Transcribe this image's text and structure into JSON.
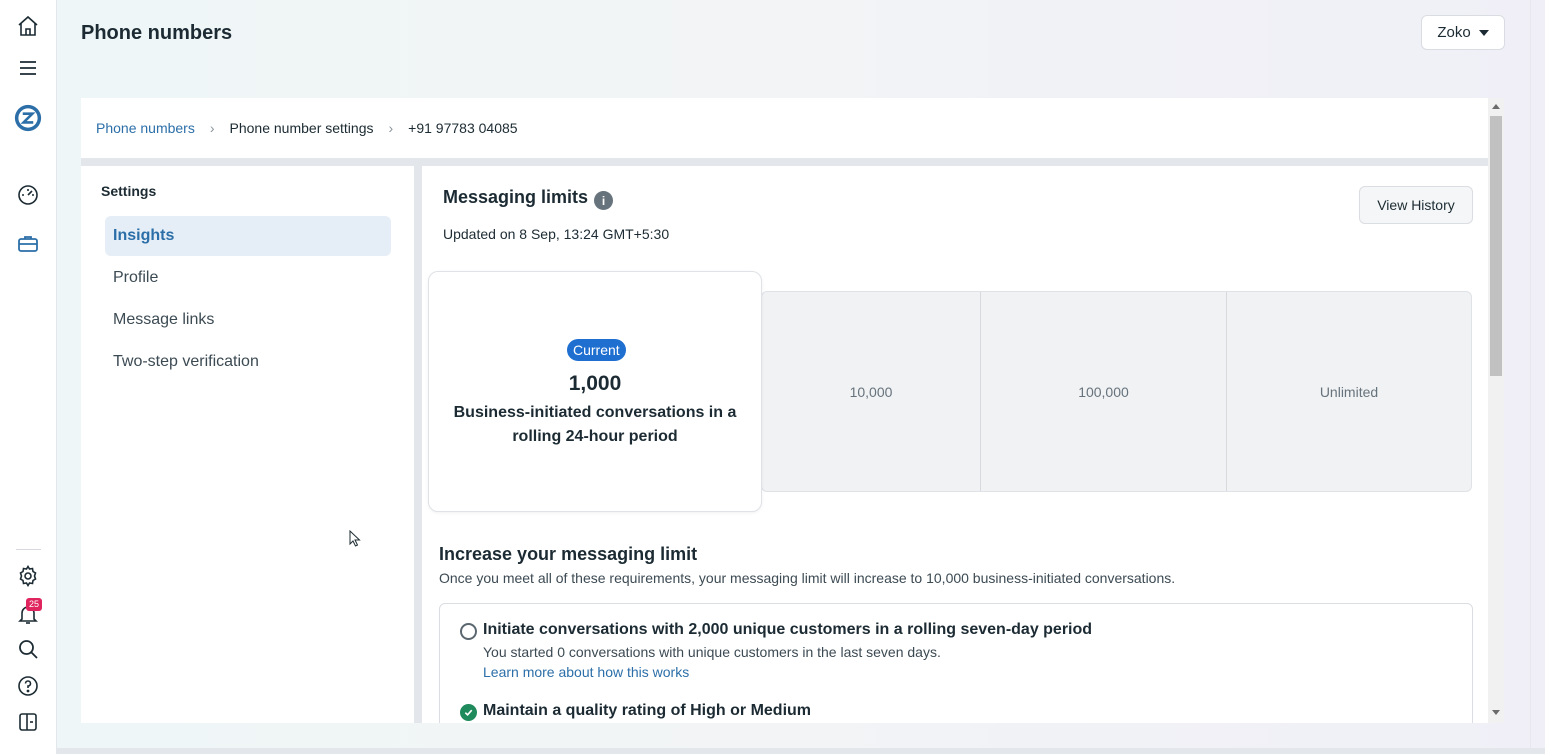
{
  "header": {
    "title": "Phone numbers",
    "account_label": "Zoko"
  },
  "breadcrumb": {
    "items": [
      "Phone numbers",
      "Phone number settings",
      "+91 97783 04085"
    ]
  },
  "settings": {
    "title": "Settings",
    "items": [
      {
        "label": "Insights",
        "active": true
      },
      {
        "label": "Profile",
        "active": false
      },
      {
        "label": "Message links",
        "active": false
      },
      {
        "label": "Two-step verification",
        "active": false
      }
    ]
  },
  "messaging_limits": {
    "title": "Messaging limits",
    "info_icon": "i",
    "updated": "Updated on 8 Sep, 13:24 GMT+5:30",
    "view_history": "View History",
    "current_pill": "Current",
    "current_value": "1,000",
    "current_desc": "Business-initiated conversations in a rolling 24-hour period",
    "tiers": [
      "10,000",
      "100,000",
      "Unlimited"
    ]
  },
  "increase": {
    "title": "Increase your messaging limit",
    "desc": "Once you meet all of these requirements, your messaging limit will increase to 10,000 business-initiated conversations.",
    "req1_title": "Initiate conversations with 2,000 unique customers in a rolling seven-day period",
    "req1_sub": "You started 0 conversations with unique customers in the last seven days.",
    "req1_link": "Learn more about how this works",
    "req2_title": "Maintain a quality rating of High or Medium"
  },
  "notifications": {
    "count": "25"
  },
  "colors": {
    "accent": "#2c6fa8",
    "pill": "#1f6fd1",
    "check": "#1f8a5b",
    "badge": "#e0245e"
  }
}
